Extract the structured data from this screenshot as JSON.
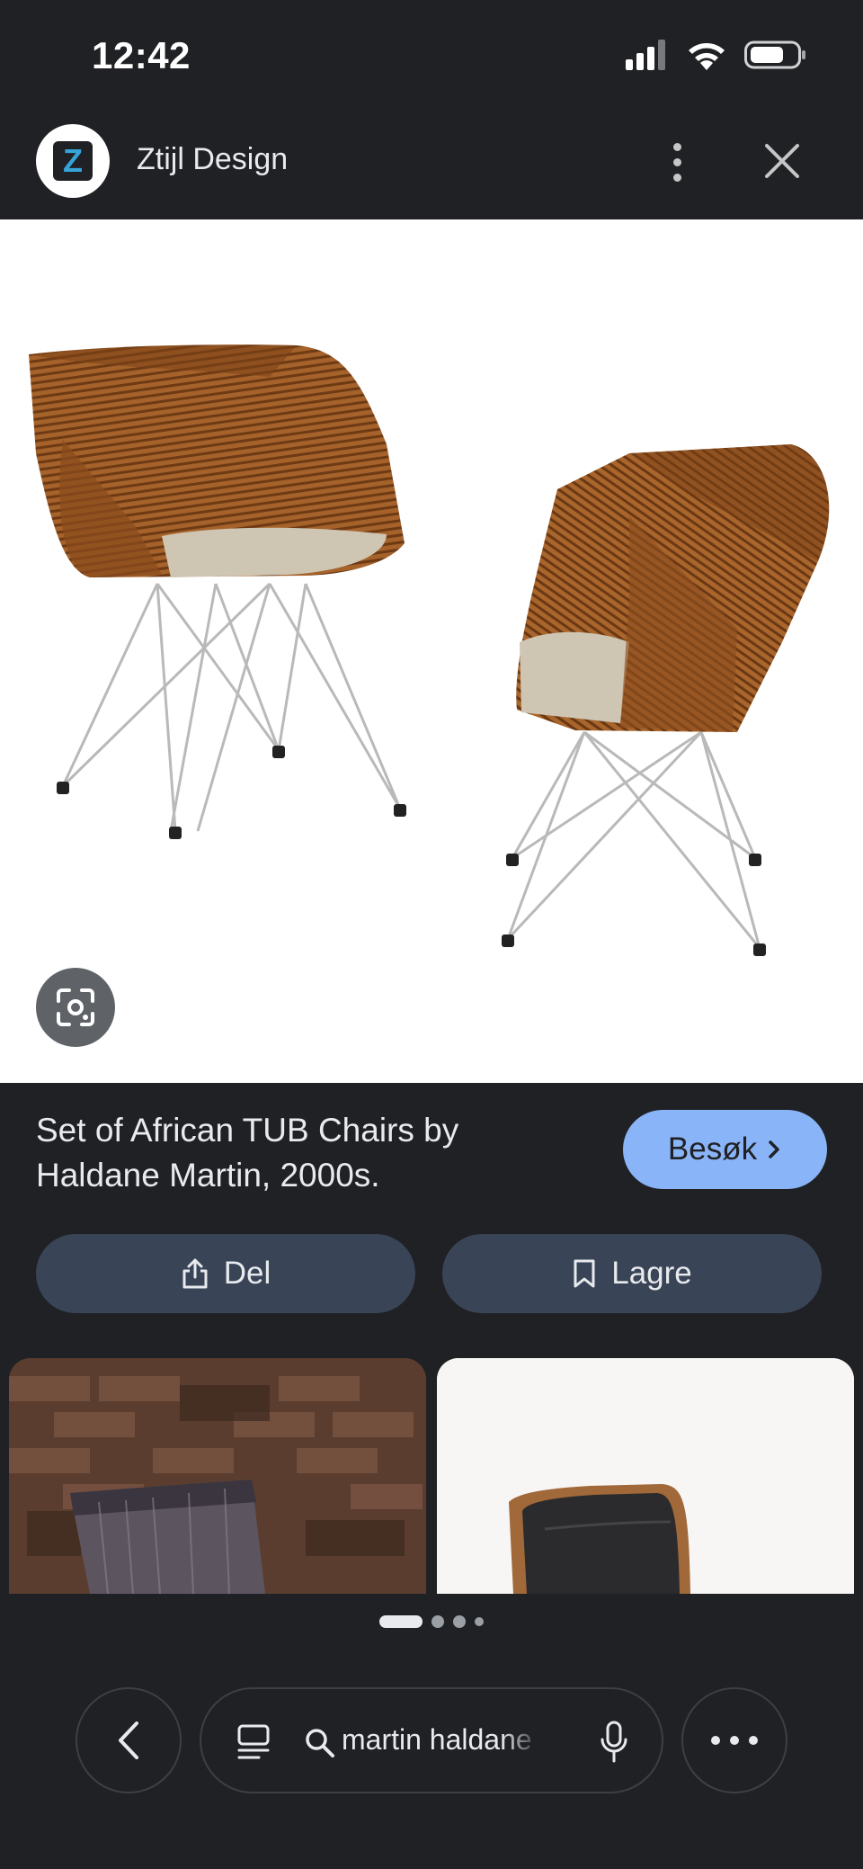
{
  "status_bar": {
    "time": "12:42"
  },
  "header": {
    "logo_letter": "Z",
    "site_name": "Ztijl Design"
  },
  "result": {
    "title": "Set of African TUB Chairs by Haldane Martin, 2000s.",
    "visit_label": "Besøk",
    "share_label": "Del",
    "save_label": "Lagre"
  },
  "bottom_bar": {
    "search_query": "martin haldane w"
  },
  "colors": {
    "background": "#202124",
    "visit_button": "#8ab4f8",
    "action_button": "#394457"
  }
}
